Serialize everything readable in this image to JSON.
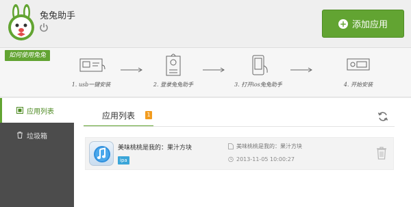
{
  "header": {
    "app_title": "兔兔助手",
    "add_app_label": "添加应用"
  },
  "howto": {
    "badge": "如何使用兔兔",
    "steps": [
      {
        "label": "1. usb一键安装"
      },
      {
        "label": "2. 登录兔兔助手"
      },
      {
        "label": "3. 打开ios兔兔助手"
      },
      {
        "label": "4. 开始安装"
      }
    ]
  },
  "sidebar": {
    "items": [
      {
        "label": "应用列表",
        "active": true
      },
      {
        "label": "垃圾箱",
        "active": false
      }
    ]
  },
  "main": {
    "tab_label": "应用列表",
    "tab_badge": "1",
    "apps": [
      {
        "name": "美味桃桃是我的：果汁方块",
        "type_tag": "ipa",
        "file_name": "美味桃桃是我的：果汁方块",
        "date": "2013-11-05 10:00:27"
      }
    ]
  },
  "colors": {
    "accent": "#62a432",
    "sidebar_bg": "#4c4c4c",
    "badge": "#f29c1f",
    "ipa_tag": "#3aa5d8"
  }
}
